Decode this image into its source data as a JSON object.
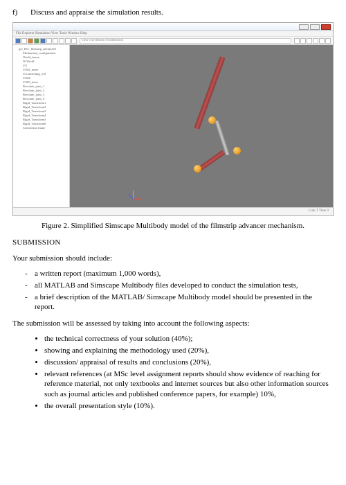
{
  "question": {
    "letter": "f)",
    "text": "Discuss and appraise the simulation results."
  },
  "app": {
    "menubar": "File  Explorer  Simulation  View  Tools  Window  Help",
    "toolbar_field": "view convention  FrontBottom",
    "tree": {
      "root": "gcf_Rev_filmstrip_advancer0",
      "items": [
        "Mechanism_configuration",
        "World_frame",
        "W World",
        "f3 l",
        "f3 l02_inner",
        "f3 connecting_rod",
        "f3 l04",
        "f3 l05_inner",
        "Revolute_joint_1",
        "Revolute_joint_2",
        "Revolute_joint_3",
        "Revolute_joint_4",
        "Rigid_Transform1",
        "Rigid_Transform2",
        "Rigid_Transform3",
        "Rigid_Transform4",
        "Rigid_Transform5",
        "Rigid_Transform6",
        "Connection frame"
      ]
    },
    "status": "Link   T   Time  0"
  },
  "figure_caption": "Figure 2. Simplified Simscape Multibody model of the filmstrip advancer mechanism.",
  "submission_heading": "SUBMISSION",
  "submission_intro": "Your submission should include:",
  "submission_items": [
    "a written report (maximum 1,000 words),",
    "all MATLAB and Simscape Multibody files developed to conduct the simulation tests,",
    "a brief description of the MATLAB/ Simscape Multibody model should be presented in the report."
  ],
  "assessment_intro": "The submission will be assessed by taking into account the following aspects:",
  "assessment_items": [
    "the technical correctness of your solution (40%);",
    "showing and explaining the methodology used (20%),",
    "discussion/ appraisal of results and conclusions (20%),",
    "relevant references (at MSc level assignment reports should show evidence of reaching for reference material, not only textbooks and internet sources but also other information sources such as journal articles and published conference papers, for example) 10%,",
    "the overall presentation style (10%)."
  ]
}
